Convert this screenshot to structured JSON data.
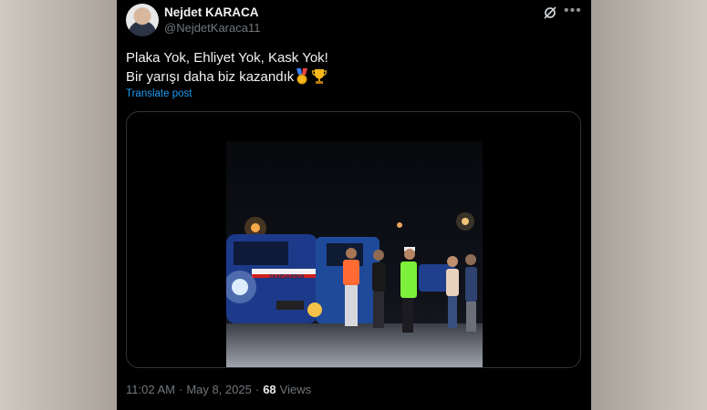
{
  "post": {
    "author_name": "Nejdet KARACA",
    "author_handle": "@NejdetKaraca11",
    "text_line1": "Plaka Yok, Ehliyet Yok, Kask Yok!",
    "text_line2": "Bir yarışı daha biz kazandık",
    "translate_label": "Translate post",
    "time": "11:02 AM",
    "separator": "·",
    "date": "May 8, 2025",
    "views_count": "68",
    "views_label": "Views"
  },
  "icons": {
    "menu": "more-icon",
    "grok": "grok-icon",
    "emoji1": "medal-icon",
    "emoji2": "trophy-icon"
  },
  "colors": {
    "background": "#000000",
    "link": "#1d9bf0",
    "muted": "#71767b",
    "text": "#e7e9ea"
  },
  "media": {
    "vehicle_text": "JANDARMA"
  }
}
